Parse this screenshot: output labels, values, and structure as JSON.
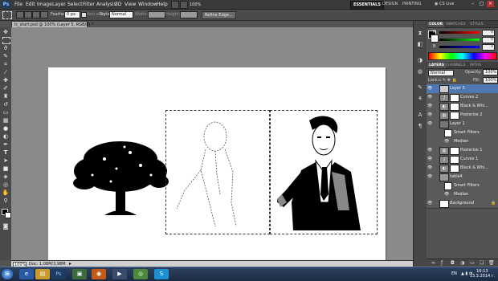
{
  "menubar": {
    "logo": "Ps",
    "items": [
      "File",
      "Edit",
      "Image",
      "Layer",
      "Select",
      "Filter",
      "Analysis",
      "3D",
      "View",
      "Window",
      "Help"
    ],
    "zoom": "100%",
    "workspaces": [
      "ESSENTIALS",
      "DESIGN",
      "PAINTING"
    ],
    "cslive": "CS Live",
    "win_min": "–",
    "win_max": "□",
    "win_close": "×"
  },
  "options": {
    "feather_label": "Feather:",
    "feather_value": "0 px",
    "antialias_label": "Anti-alias",
    "style_label": "Style:",
    "style_value": "Normal",
    "width_label": "Width:",
    "height_label": "Height:",
    "refine_edge": "Refine Edge..."
  },
  "document": {
    "tab_title": "lc_start.psd @ 100% (Layer 5, RGB/8) *",
    "status_zoom": "100%",
    "status_doc": "Doc: 1,08M/3,98M"
  },
  "color_panel": {
    "tabs": [
      "COLOR",
      "SWATCHES",
      "STYLES"
    ],
    "channels": [
      {
        "label": "R",
        "value": "0"
      },
      {
        "label": "G",
        "value": "0"
      },
      {
        "label": "B",
        "value": "0"
      }
    ]
  },
  "layers_panel": {
    "tabs": [
      "LAYERS",
      "CHANNELS",
      "PATHS"
    ],
    "blend_mode": "Normal",
    "opacity_label": "Opacity:",
    "opacity_value": "100%",
    "lock_label": "Lock:",
    "fill_label": "Fill:",
    "fill_value": "100%",
    "layers": [
      {
        "name": "Layer 5",
        "type": "pixel",
        "selected": true
      },
      {
        "name": "Curves 2",
        "type": "adjust"
      },
      {
        "name": "Black & Whi...",
        "type": "adjust"
      },
      {
        "name": "Posterize 2",
        "type": "adjust"
      },
      {
        "name": "Layer 1",
        "type": "pixel"
      },
      {
        "name": "Smart Filters",
        "type": "sub"
      },
      {
        "name": "Median",
        "type": "sub"
      },
      {
        "name": "Posterize 1",
        "type": "adjust"
      },
      {
        "name": "Curves 1",
        "type": "adjust"
      },
      {
        "name": "Black & Whi...",
        "type": "adjust"
      },
      {
        "name": "table4",
        "type": "pixel"
      },
      {
        "name": "Smart Filters",
        "type": "sub"
      },
      {
        "name": "Median",
        "type": "sub"
      },
      {
        "name": "Background",
        "type": "pixel"
      }
    ]
  },
  "taskbar": {
    "apps": [
      "Start",
      "IE",
      "Explorer",
      "Photoshop",
      "Files",
      "Firefox",
      "Media",
      "Chrome",
      "Skype"
    ],
    "lang": "EN",
    "time": "16:13",
    "date": "13.3.2014 г."
  },
  "colors": {
    "accent": "#4f78b3",
    "selected_ws": "#222222"
  }
}
